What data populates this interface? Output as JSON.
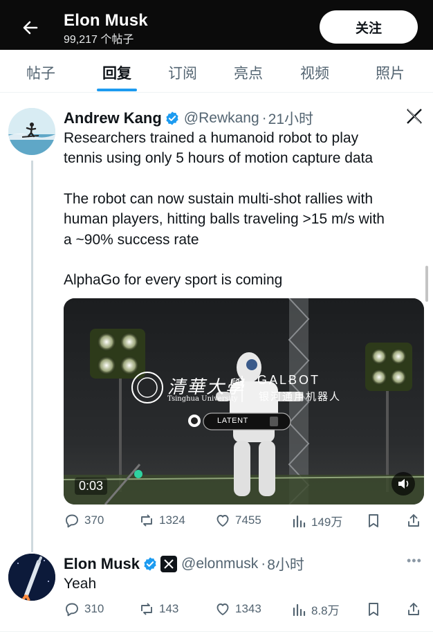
{
  "header": {
    "title": "Elon Musk",
    "subtitle": "99,217 个帖子",
    "follow_label": "关注",
    "back_icon": "arrow-left-icon"
  },
  "tabs": [
    {
      "label": "帖子",
      "active": false
    },
    {
      "label": "回复",
      "active": true
    },
    {
      "label": "订阅",
      "active": false
    },
    {
      "label": "亮点",
      "active": false
    },
    {
      "label": "视频",
      "active": false
    },
    {
      "label": "照片",
      "active": false
    }
  ],
  "tweet1": {
    "name": "Andrew Kang",
    "handle": "@Rewkang",
    "sep": "·",
    "time": "21小时",
    "lines": [
      "Researchers trained a humanoid robot to play",
      "tennis using only 5 hours of motion capture data",
      "The robot can now sustain multi-shot rallies with",
      "human players, hitting balls traveling >15 m/s with",
      "a ~90% success rate",
      "AlphaGo for every sport is coming"
    ],
    "video": {
      "time": "0:03",
      "watermark_left": "清華大學",
      "watermark_left_sub": "Tsinghua University",
      "watermark_right": "GALBOT",
      "watermark_right_sub": "银河通用机器人",
      "badge": "LATENT"
    },
    "stats": {
      "replies": "370",
      "reposts": "1324",
      "likes": "7455",
      "views": "149万"
    }
  },
  "tweet2": {
    "name": "Elon Musk",
    "handle": "@elonmusk",
    "sep": "·",
    "time": "8小时",
    "text": "Yeah",
    "stats": {
      "replies": "310",
      "reposts": "143",
      "likes": "1343",
      "views": "8.8万"
    }
  },
  "colors": {
    "header_bg": "#0b0b0b",
    "accent": "#1d9bf0",
    "muted": "#536471",
    "text": "#0f1419"
  }
}
